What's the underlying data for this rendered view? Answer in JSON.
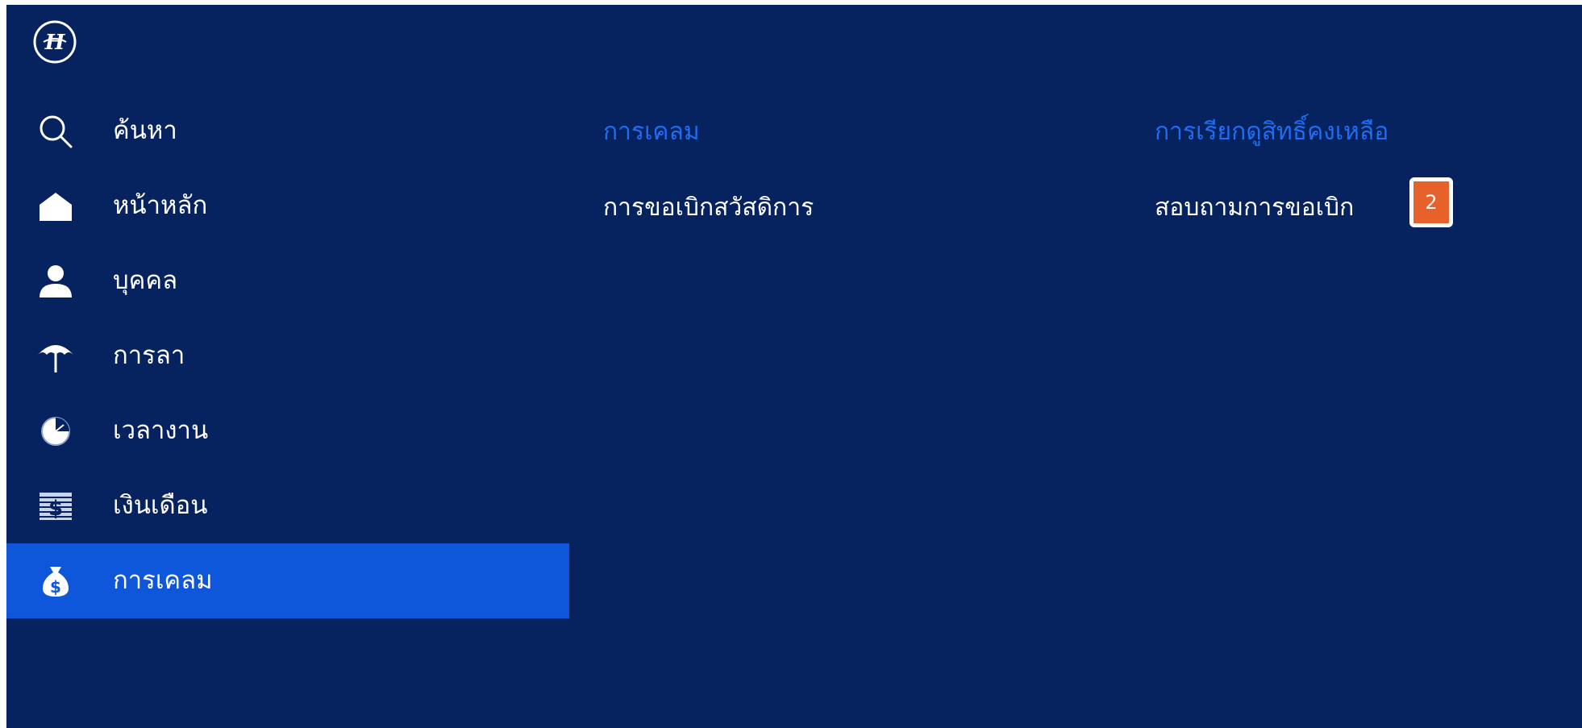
{
  "logo": {
    "icon": "company-logo-icon"
  },
  "sidebar": {
    "items": [
      {
        "label": "ค้นหา",
        "icon": "search-icon"
      },
      {
        "label": "หน้าหลัก",
        "icon": "home-icon"
      },
      {
        "label": "บุคคล",
        "icon": "person-icon"
      },
      {
        "label": "การลา",
        "icon": "umbrella-icon"
      },
      {
        "label": "เวลางาน",
        "icon": "clock-icon"
      },
      {
        "label": "เงินเดือน",
        "icon": "salary-icon"
      },
      {
        "label": "การเคลม",
        "icon": "money-bag-icon",
        "active": true
      }
    ]
  },
  "main": {
    "columns": [
      {
        "title": "การเคลม",
        "links": [
          "การขอเบิกสวัสดิการ"
        ]
      },
      {
        "title": "การเรียกดูสิทธิ์คงเหลือ",
        "links": [
          "สอบถามการขอเบิก"
        ],
        "badge": "2"
      }
    ]
  },
  "colors": {
    "background": "#06225f",
    "active_item": "#0e56da",
    "section_title": "#1f6df2",
    "badge": "#e7622b"
  }
}
